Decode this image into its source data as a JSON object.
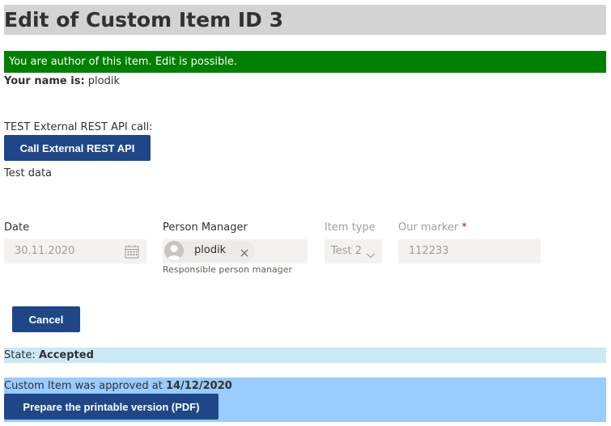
{
  "page": {
    "title": "Edit of Custom Item ID 3",
    "author_banner": "You are author of this item. Edit is possible."
  },
  "user": {
    "label": "Your name is:",
    "name": "plodik"
  },
  "rest_api": {
    "label": "TEST External REST API call:",
    "button_label": "Call External REST API",
    "result_text": "Test data"
  },
  "form": {
    "date": {
      "label": "Date",
      "value": "30.11.2020",
      "icon": "calendar-icon"
    },
    "person_manager": {
      "label": "Person Manager",
      "value": "plodik",
      "description": "Responsible person manager",
      "remove_icon": "close-icon",
      "avatar_icon": "person-icon"
    },
    "item_type": {
      "label": "Item type",
      "value": "Test 2",
      "icon": "chevron-down-icon"
    },
    "our_marker": {
      "label": "Our marker",
      "required_mark": "*",
      "value": "112233"
    }
  },
  "actions": {
    "cancel_label": "Cancel"
  },
  "state": {
    "label": "State:",
    "value": "Accepted"
  },
  "approval": {
    "text": "Custom Item was approved at",
    "date": "14/12/2020",
    "pdf_button_label": "Prepare the printable version (PDF)"
  },
  "colors": {
    "title_bg": "#d3d3d3",
    "author_banner_bg": "#008000",
    "button_bg": "#1f4788",
    "state_bg": "#cce9f7",
    "approval_bg": "#99ccff",
    "disabled_input_bg": "#f3f2f1"
  }
}
